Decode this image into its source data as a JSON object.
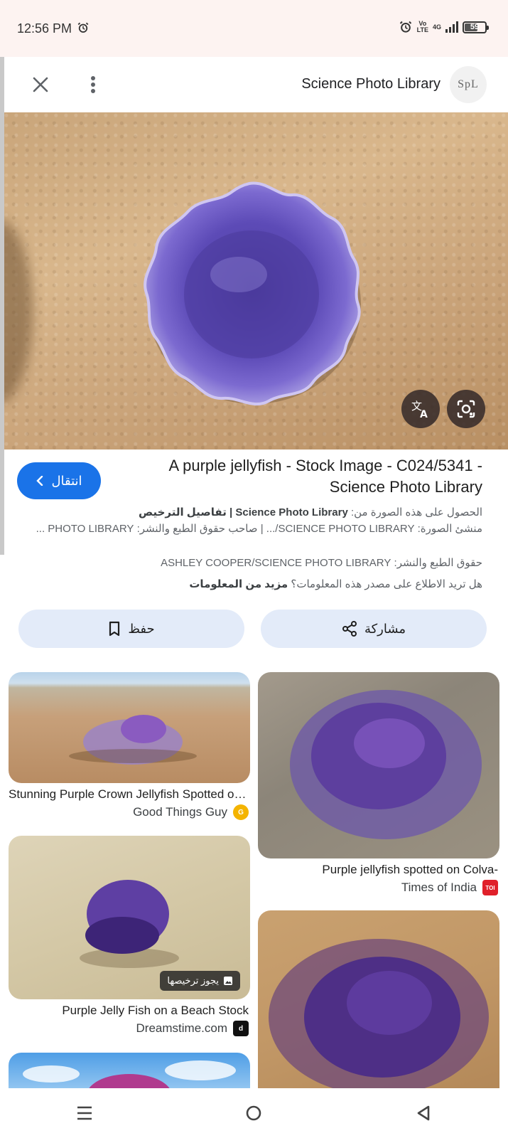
{
  "status_bar": {
    "time": "12:56 PM",
    "network_top": "Vo",
    "network_bottom": "LTE",
    "network_gen": "4G",
    "battery": "59"
  },
  "header": {
    "title": "Science Photo Library",
    "logo_text": "SpL",
    "icons": [
      "close-icon",
      "more-vertical-icon"
    ]
  },
  "result": {
    "visit_label": "انتقال",
    "title": "A purple jellyfish - Stock Image - C024/5341 - Science Photo Library",
    "get_image_prefix": "الحصول على هذه الصورة من:",
    "get_image_source": "Science Photo Library",
    "license_details": "| تفاصيل الترخيص",
    "creator_line": "منشئ الصورة: SCIENCE PHOTO LIBRARY/... | صاحب حقوق الطبع والنشر: PHOTO LIBRARY ...",
    "copyright_line": "حقوق الطبع والنشر: ASHLEY COOPER/SCIENCE PHOTO LIBRARY",
    "source_question": "هل تريد الاطلاع على مصدر هذه المعلومات؟",
    "more_info": "مزيد من المعلومات"
  },
  "actions": {
    "save_label": "حفظ",
    "share_label": "مشاركة"
  },
  "related": [
    {
      "title": "Stunning Purple Crown Jellyfish Spotted on...",
      "source": "Good Things Guy",
      "favicon": "G",
      "favicon_color": "#f4b400"
    },
    {
      "title": "Purple jellyfish spotted on Colva-",
      "source": "Times of India",
      "favicon": "TOI",
      "favicon_color": "#e0202a"
    },
    {
      "title": "Purple Jelly Fish on a Beach Stock",
      "source": "Dreamstime.com",
      "favicon": "d",
      "favicon_color": "#111111",
      "badge": "يجوز ترخيصها"
    },
    {
      "title": "",
      "source": ""
    },
    {
      "title": "",
      "source": ""
    }
  ],
  "nav": {
    "icons": [
      "recent-apps-icon",
      "home-icon",
      "back-icon"
    ]
  },
  "colors": {
    "accent": "#1a73e8",
    "pill_bg": "#e3ebf9"
  }
}
